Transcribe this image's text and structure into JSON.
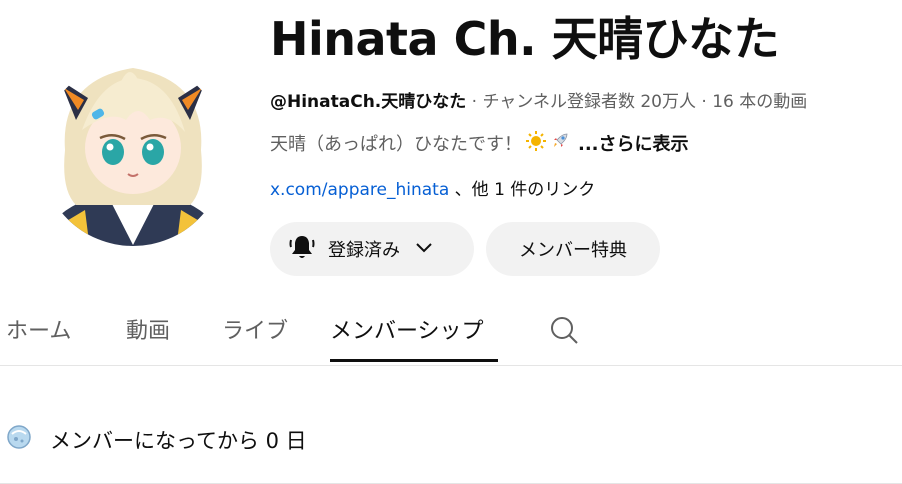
{
  "channel": {
    "name": "Hinata Ch. 天晴ひなた",
    "handle": "@HinataCh.天晴ひなた",
    "stats": " · チャンネル登録者数 20万人 · 16 本の動画",
    "description": "天晴（あっぱれ）ひなたです！",
    "description_emojis": [
      "sun-emoji",
      "rocket-emoji"
    ],
    "more_label": "...さらに表示",
    "link_url": "x.com/appare_hinata",
    "link_rest": " 、他 1 件のリンク"
  },
  "buttons": {
    "subscribe_label": "登録済み",
    "member_perks_label": "メンバー特典"
  },
  "tabs": [
    {
      "label": "ホーム"
    },
    {
      "label": "動画"
    },
    {
      "label": "ライブ"
    },
    {
      "label": "メンバーシップ",
      "active": true
    }
  ],
  "membership": {
    "status_text": "メンバーになってから 0 日"
  },
  "colors": {
    "link": "#065fd4",
    "button_bg": "#f2f2f2",
    "text_primary": "#0f0f0f",
    "text_secondary": "#606060"
  }
}
